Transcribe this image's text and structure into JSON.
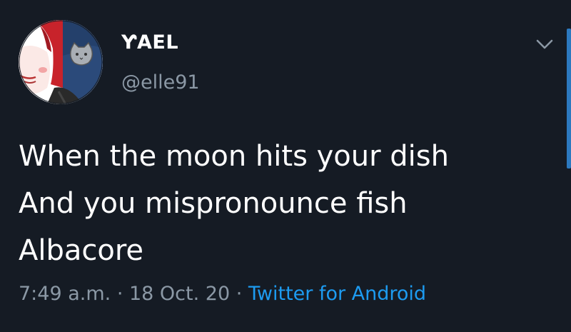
{
  "user": {
    "display_name": "ƳAEL",
    "handle": "@elle91"
  },
  "tweet": {
    "lines": [
      "When the moon hits your dish",
      "And you mispronounce fish",
      "Albacore"
    ]
  },
  "meta": {
    "time": "7:49 a.m.",
    "separator": " · ",
    "date": "18 Oct. 20",
    "source": "Twitter for Android"
  },
  "colors": {
    "background": "#151b24",
    "text": "#ffffff",
    "secondary": "#8b98a5",
    "link": "#1d9bf0",
    "scrollbar": "#2c79bf"
  },
  "icons": {
    "menu": "chevron-down-icon",
    "avatar": "profile-avatar-illustration"
  }
}
